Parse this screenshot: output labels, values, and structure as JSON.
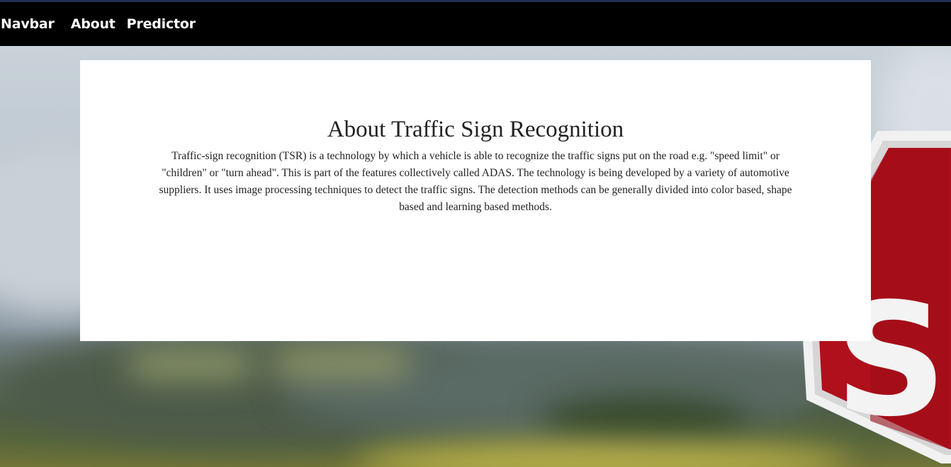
{
  "navbar": {
    "brand": "Navbar",
    "links": [
      {
        "label": "About"
      },
      {
        "label": "Predictor"
      }
    ]
  },
  "about": {
    "title": "About Traffic Sign Recognition",
    "body": "Traffic-sign recognition (TSR) is a technology by which a vehicle is able to recognize the traffic signs put on the road e.g. \"speed limit\" or \"children\" or \"turn ahead\". This is part of the features collectively called ADAS. The technology is being developed by a variety of automotive suppliers. It uses image processing techniques to detect the traffic signs. The detection methods can be generally divided into color based, shape based and learning based methods."
  },
  "background": {
    "sign_text": "ST",
    "colors": {
      "sign_red": "#b0101c",
      "sign_border": "#f2f2f2",
      "navbar": "#000000",
      "top_accent": "#1f2f55",
      "card": "#ffffff"
    }
  }
}
